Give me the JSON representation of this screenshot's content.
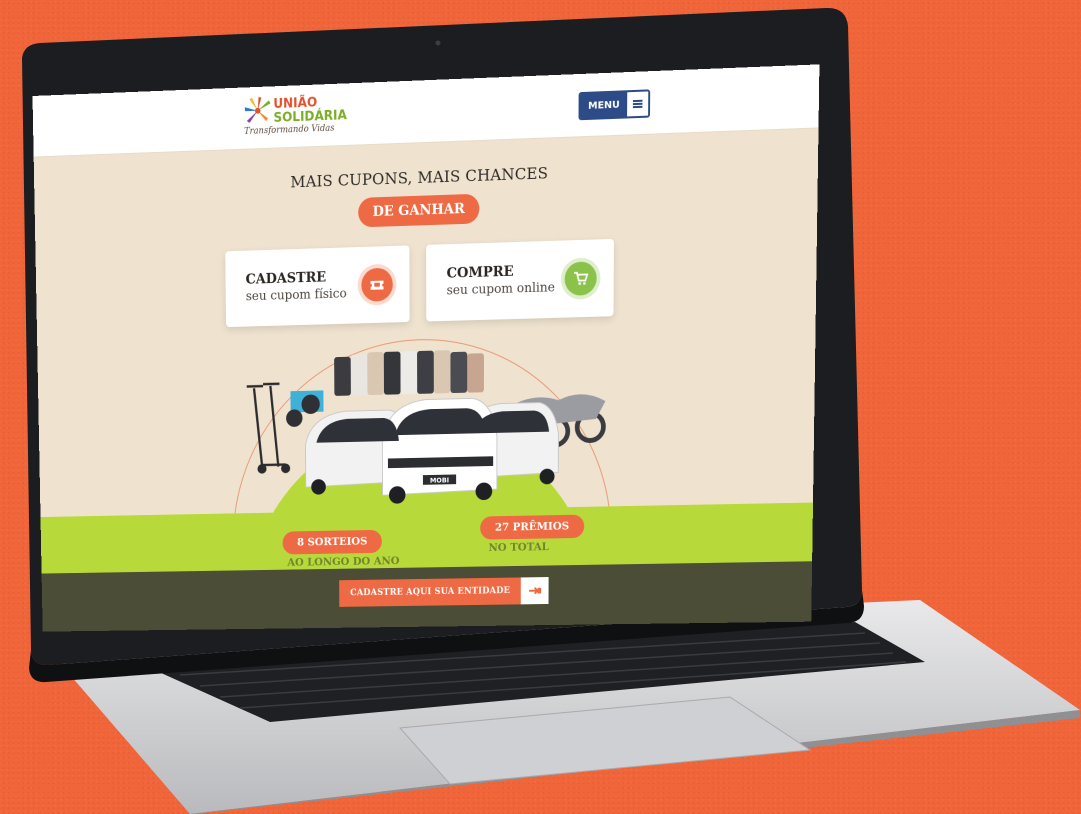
{
  "site": {
    "logo": {
      "line1": "UNIÃO",
      "line2": "SOLIDÁRIA",
      "tagline": "Transformando Vidas"
    },
    "menu_label": "MENU"
  },
  "hero": {
    "headline": "MAIS CUPONS, MAIS CHANCES",
    "highlight": "DE GANHAR"
  },
  "cards": [
    {
      "title": "CADASTRE",
      "subtitle": "seu cupom físico",
      "icon": "ticket-icon",
      "color": "#ee6a44"
    },
    {
      "title": "COMPRE",
      "subtitle": "seu cupom online",
      "icon": "cart-icon",
      "color": "#8bc34a"
    }
  ],
  "prizes": {
    "plate_text": "MOBI"
  },
  "stats": [
    {
      "label": "8 SORTEIOS",
      "caption": "AO LONGO DO ANO"
    },
    {
      "label": "27 PRÊMIOS",
      "caption": "NO TOTAL"
    }
  ],
  "cta": {
    "label": "CADASTRE AQUI SUA ENTIDADE",
    "icon": "hand-pointer-icon"
  },
  "colors": {
    "background": "#f0653a",
    "accent_orange": "#ee6a44",
    "accent_green": "#b7d93a",
    "menu_blue": "#2d4b86",
    "page_beige": "#efe3cf"
  }
}
